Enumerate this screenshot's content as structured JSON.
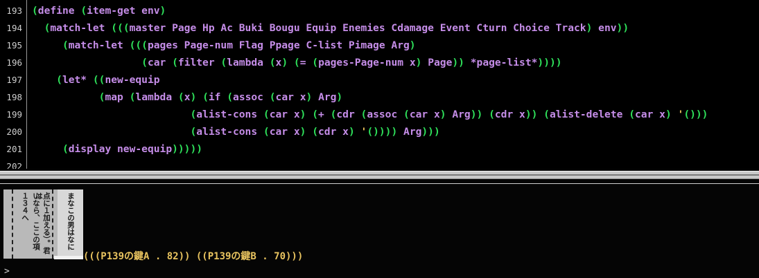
{
  "editor": {
    "lines": [
      {
        "num": "193",
        "parts": [
          [
            "p",
            "("
          ],
          [
            "k",
            "define "
          ],
          [
            "p",
            "("
          ],
          [
            "k",
            "item-get env"
          ],
          [
            "p",
            ")"
          ]
        ]
      },
      {
        "num": "194",
        "parts": [
          [
            "t",
            "  "
          ],
          [
            "p",
            "("
          ],
          [
            "k",
            "match-let "
          ],
          [
            "p",
            "((("
          ],
          [
            "k",
            "master Page Hp Ac Buki Bougu Equip Enemies Cdamage Event Cturn Choice Track"
          ],
          [
            "p",
            ")"
          ],
          [
            "k",
            " env"
          ],
          [
            "p",
            "))"
          ]
        ]
      },
      {
        "num": "195",
        "parts": [
          [
            "t",
            "     "
          ],
          [
            "p",
            "("
          ],
          [
            "k",
            "match-let "
          ],
          [
            "p",
            "((("
          ],
          [
            "k",
            "pages Page-num Flag Ppage C-list Pimage Arg"
          ],
          [
            "p",
            ")"
          ]
        ]
      },
      {
        "num": "196",
        "parts": [
          [
            "t",
            "                  "
          ],
          [
            "p",
            "("
          ],
          [
            "k",
            "car "
          ],
          [
            "p",
            "("
          ],
          [
            "k",
            "filter "
          ],
          [
            "p",
            "("
          ],
          [
            "k",
            "lambda "
          ],
          [
            "p",
            "("
          ],
          [
            "k",
            "x"
          ],
          [
            "p",
            ") ("
          ],
          [
            "k",
            "= "
          ],
          [
            "p",
            "("
          ],
          [
            "k",
            "pages-Page-num x"
          ],
          [
            "p",
            ") "
          ],
          [
            "k",
            "Page"
          ],
          [
            "p",
            "))"
          ],
          [
            "k",
            " *page-list*"
          ],
          [
            "p",
            "))))"
          ]
        ]
      },
      {
        "num": "197",
        "parts": [
          [
            "t",
            "    "
          ],
          [
            "p",
            "("
          ],
          [
            "k",
            "let* "
          ],
          [
            "p",
            "(("
          ],
          [
            "k",
            "new-equip"
          ]
        ]
      },
      {
        "num": "198",
        "parts": [
          [
            "t",
            "           "
          ],
          [
            "p",
            "("
          ],
          [
            "k",
            "map "
          ],
          [
            "p",
            "("
          ],
          [
            "k",
            "lambda "
          ],
          [
            "p",
            "("
          ],
          [
            "k",
            "x"
          ],
          [
            "p",
            ") ("
          ],
          [
            "k",
            "if "
          ],
          [
            "p",
            "("
          ],
          [
            "k",
            "assoc "
          ],
          [
            "p",
            "("
          ],
          [
            "k",
            "car x"
          ],
          [
            "p",
            ") "
          ],
          [
            "k",
            "Arg"
          ],
          [
            "p",
            ")"
          ]
        ]
      },
      {
        "num": "199",
        "parts": [
          [
            "t",
            "                          "
          ],
          [
            "p",
            "("
          ],
          [
            "k",
            "alist-cons "
          ],
          [
            "p",
            "("
          ],
          [
            "k",
            "car x"
          ],
          [
            "p",
            ") ("
          ],
          [
            "k",
            "+ "
          ],
          [
            "p",
            "("
          ],
          [
            "k",
            "cdr "
          ],
          [
            "p",
            "("
          ],
          [
            "k",
            "assoc "
          ],
          [
            "p",
            "("
          ],
          [
            "k",
            "car x"
          ],
          [
            "p",
            ") "
          ],
          [
            "k",
            "Arg"
          ],
          [
            "p",
            "))"
          ],
          [
            "p",
            " ("
          ],
          [
            "k",
            "cdr x"
          ],
          [
            "p",
            "))"
          ],
          [
            "p",
            " ("
          ],
          [
            "k",
            "alist-delete "
          ],
          [
            "p",
            "("
          ],
          [
            "k",
            "car x"
          ],
          [
            "p",
            ") "
          ],
          [
            "q",
            "'"
          ],
          [
            "p",
            "()))"
          ]
        ]
      },
      {
        "num": "200",
        "parts": [
          [
            "t",
            "                          "
          ],
          [
            "p",
            "("
          ],
          [
            "k",
            "alist-cons "
          ],
          [
            "p",
            "("
          ],
          [
            "k",
            "car x"
          ],
          [
            "p",
            ") ("
          ],
          [
            "k",
            "cdr x"
          ],
          [
            "p",
            ") "
          ],
          [
            "q",
            "'"
          ],
          [
            "p",
            "()))) "
          ],
          [
            "k",
            "Arg"
          ],
          [
            "p",
            ")))"
          ]
        ]
      },
      {
        "num": "201",
        "parts": [
          [
            "t",
            "     "
          ],
          [
            "p",
            "("
          ],
          [
            "k",
            "display new-equip"
          ],
          [
            "p",
            ")))))"
          ]
        ]
      },
      {
        "num": "202",
        "parts": []
      }
    ]
  },
  "repl": {
    "scan_columns": [
      "１３４へ",
      "いなら、ここの項",
      "点に１加える）。君は"
    ],
    "scan_right": "まなこの男はなに",
    "result_text": "(((P139の鍵A . 82)) ((P139の鍵B . 70)))",
    "prompt": ">"
  },
  "colors": {
    "paren": "#2ee05a",
    "keyword": "#c58de8",
    "quote": "#e9c05a",
    "result": "#e8c35f"
  }
}
